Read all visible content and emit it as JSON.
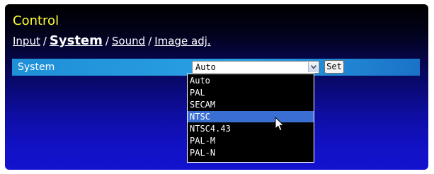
{
  "header": {
    "title": "Control",
    "breadcrumb": {
      "items": [
        "Input",
        "System",
        "Sound",
        "Image adj."
      ],
      "separator": "/",
      "active": "System"
    }
  },
  "setting_row": {
    "label": "System",
    "select": {
      "value": "Auto",
      "options": [
        "Auto",
        "PAL",
        "SECAM",
        "NTSC",
        "NTSC4.43",
        "PAL-M",
        "PAL-N"
      ],
      "highlighted": "NTSC"
    },
    "set_button": "Set"
  },
  "icons": {
    "dropdown_arrow": "chevron-down-icon",
    "pointer": "mouse-pointer-icon"
  },
  "colors": {
    "title": "#ffff33",
    "row_bar": "#2aa0e2",
    "highlight": "#3a6ed2"
  }
}
